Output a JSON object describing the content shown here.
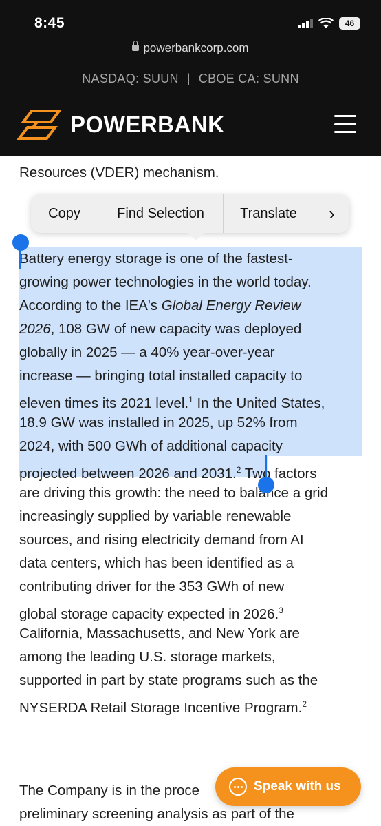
{
  "status_bar": {
    "time": "8:45",
    "battery": "46"
  },
  "browser": {
    "url": "powerbankcorp.com"
  },
  "ticker": {
    "nasdaq": "NASDAQ: SUUN",
    "separator": "|",
    "cboe": "CBOE CA: SUNN"
  },
  "header": {
    "brand": "POWERBANK"
  },
  "context_menu": {
    "copy": "Copy",
    "find_selection": "Find Selection",
    "translate": "Translate",
    "more": "›"
  },
  "article": {
    "line_00": "Resources (VDER) mechanism.",
    "line_01": "Battery energy storage is one of the fastest-",
    "line_02": "growing power technologies in the world today.",
    "line_03a": "According to the IEA's ",
    "line_03b": "Global Energy Review",
    "line_04a": "2026",
    "line_04b": ", 108 GW of new capacity was deployed",
    "line_05": "globally in 2025 — a 40% year-over-year",
    "line_06": "increase — bringing total installed capacity to",
    "line_07a": "eleven times its 2021 level.",
    "line_07b": "1",
    "line_07c": " In the United States,",
    "line_08": "18.9 GW was installed in 2025, up 52% from",
    "line_09": "2024, with 500 GWh of additional capacity",
    "line_10a": "projected between 2026 and 2031.",
    "line_10b": "2",
    "line_10c": " Two factors",
    "line_11": "are driving this growth: the need to balance a grid",
    "line_12": "increasingly supplied by variable renewable",
    "line_13": "sources, and rising electricity demand from AI",
    "line_14": "data centers, which has been identified as a",
    "line_15": "contributing driver for the 353 GWh of new",
    "line_16a": "global storage capacity expected in 2026.",
    "line_16b": "3",
    "line_17": "California, Massachusetts, and New York are",
    "line_18": "among the leading U.S. storage markets,",
    "line_19": "supported in part by state programs such as the",
    "line_20a": "NYSERDA Retail Storage Incentive Program.",
    "line_20b": "2",
    "line_21": "The Company is in the proce",
    "line_22": "preliminary screening analysis as part of the"
  },
  "chat": {
    "label": "Speak with us"
  },
  "colors": {
    "header_bg": "#111111",
    "accent": "#f5921e",
    "selection": "#cfe2fb",
    "handle": "#1a73e8"
  }
}
